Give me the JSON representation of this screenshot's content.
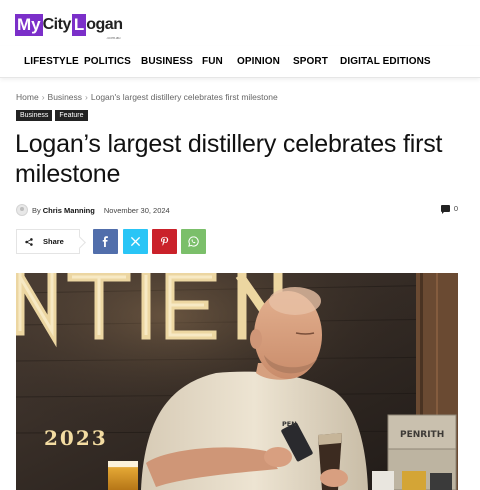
{
  "site": {
    "logo_part1": "My",
    "logo_part2": "City",
    "logo_part3": "L",
    "logo_part4": "ogan",
    "logo_tagline": ".com.au"
  },
  "nav": {
    "items": [
      "LIFESTYLE",
      "POLITICS",
      "BUSINESS",
      "FUN",
      "OPINION",
      "SPORT",
      "DIGITAL EDITIONS"
    ]
  },
  "breadcrumb": {
    "home": "Home",
    "section": "Business",
    "current": "Logan's largest distillery celebrates first milestone"
  },
  "tags": [
    "Business",
    "Feature"
  ],
  "article": {
    "title": "Logan’s largest distillery celebrates first milestone",
    "by_label": "By",
    "author": "Chris Manning",
    "date": "November 30, 2024",
    "comment_count": "0"
  },
  "share": {
    "label": "Share",
    "buttons": [
      {
        "name": "facebook",
        "icon": "facebook-icon",
        "color": "#516eab"
      },
      {
        "name": "twitter",
        "icon": "x-icon",
        "color": "#29c5f6"
      },
      {
        "name": "pinterest",
        "icon": "pinterest-icon",
        "color": "#ca212a"
      },
      {
        "name": "whatsapp",
        "icon": "whatsapp-icon",
        "color": "#7bbf6a"
      }
    ]
  },
  "hero_image": {
    "sign_text": "NTIE",
    "year_text": "2023",
    "can_text": "PENRITH",
    "shirt_text": "PEN"
  },
  "colors": {
    "brand_purple": "#7b2fc9",
    "tag_bg": "#222222",
    "neon_sign": "#f5dfa8"
  }
}
